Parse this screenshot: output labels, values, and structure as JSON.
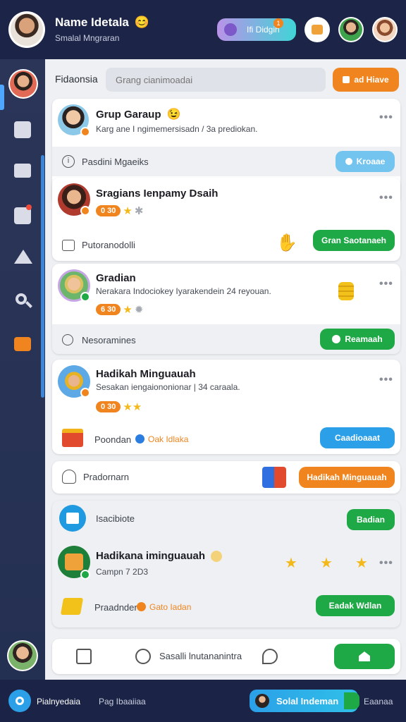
{
  "header": {
    "name": "Name Idetala",
    "emoji": "😊",
    "subtitle": "Smalal Mngraran",
    "pill_label": "Ifi Didgih",
    "pill_badge": "1"
  },
  "search": {
    "left_label": "Fidaonsia",
    "placeholder": "Grang cianimoadai",
    "button_label": "ad Hiave"
  },
  "cards": [
    {
      "title": "Grup Garaup",
      "emoji": "😉",
      "desc": "Karg ane I ngimemersisadn / 3a prediokan.",
      "footer_label": "Pasdini Mgaeiks",
      "footer_button": "Kroaae"
    },
    {
      "title": "Sragians Ienpamy Dsaih",
      "score": "0 30",
      "footer_label": "Putoranodolli",
      "footer_button": "Gran Saotanaeh"
    },
    {
      "title": "Gradian",
      "desc": "Nerakara Indociokey Iyarakendein 24 reyouan.",
      "score": "6 30",
      "footer_label": "Nesoramines",
      "footer_button": "Reamaah"
    },
    {
      "title": "Hadikah Minguauah",
      "desc": "Sesakan iengaiononionar | 34 caraala.",
      "score": "0 30",
      "footer_label": "Poondan",
      "footer_link": "Oak Idlaka",
      "footer_button": "Caadioaaat"
    }
  ],
  "promo": {
    "label": "Pradornarn",
    "button": "Hadikah Minguauah"
  },
  "bottom_card": {
    "header_label": "Isacibiote",
    "header_button": "Badian",
    "title": "Hadikana iminguauah",
    "date": "Campn 7 2D3",
    "footer_label": "Praadnder",
    "footer_link": "Gato Iadan",
    "footer_button": "Eadak Wdlan"
  },
  "tabbar": {
    "middle_label": "Sasalli lnutananintra"
  },
  "footer": {
    "left_label": "Pialnyedaia",
    "middle_label": "Pag Ibaaiiaa",
    "cta_label": "Solal Indeman",
    "right_label": "Eaanaa"
  },
  "colors": {
    "accent_green": "#1fa846",
    "accent_orange": "#f0851f",
    "accent_blue": "#2ba0e8",
    "nav_bg": "#1c2547"
  }
}
